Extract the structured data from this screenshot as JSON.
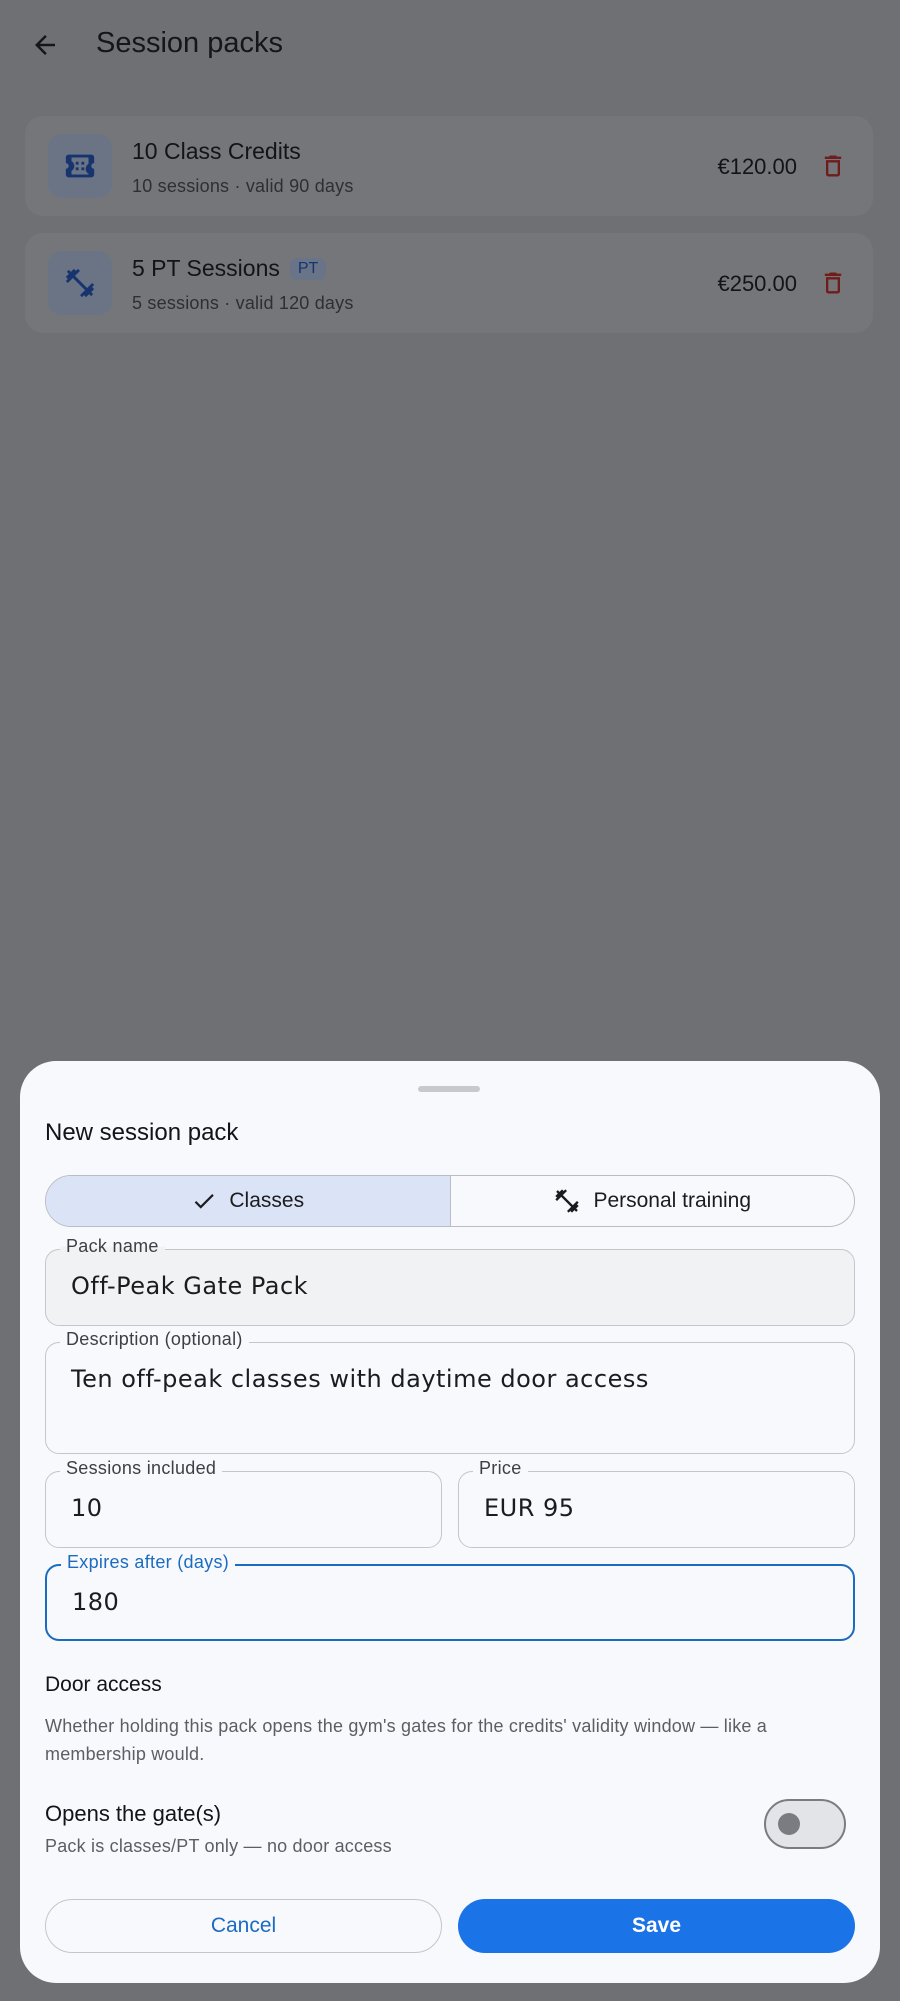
{
  "header": {
    "title": "Session packs",
    "back_icon": "arrow-left-icon"
  },
  "packs": [
    {
      "name": "10 Class Credits",
      "meta": "10 sessions · valid 90 days",
      "price": "€120.00",
      "badge": "",
      "icon": "ticket-icon"
    },
    {
      "name": "5 PT Sessions",
      "meta": "5 sessions · valid 120 days",
      "price": "€250.00",
      "badge": "PT",
      "icon": "dumbbell-icon"
    }
  ],
  "sheet": {
    "title": "New session pack",
    "segments": [
      {
        "label": "Classes",
        "selected": true,
        "icon": "check-icon"
      },
      {
        "label": "Personal training",
        "selected": false,
        "icon": "dumbbell-icon"
      }
    ],
    "fields": {
      "name": {
        "label": "Pack name",
        "value": "Off-Peak Gate Pack"
      },
      "description": {
        "label": "Description (optional)",
        "value": "Ten off-peak classes with daytime door access"
      },
      "sessions": {
        "label": "Sessions included",
        "value": "10"
      },
      "price": {
        "label": "Price",
        "value": "EUR 95"
      },
      "expires": {
        "label": "Expires after (days)",
        "value": "180"
      }
    },
    "door_access": {
      "title": "Door access",
      "description": "Whether holding this pack opens the gym's gates for the credits' validity window — like a membership would."
    },
    "gate_toggle": {
      "title": "Opens the gate(s)",
      "subtitle": "Pack is classes/PT only — no door access",
      "on": false
    },
    "buttons": {
      "cancel": "Cancel",
      "save": "Save"
    }
  },
  "colors": {
    "accent": "#1b73e8",
    "delete": "#b3261e",
    "scrim": "#6f7073"
  }
}
